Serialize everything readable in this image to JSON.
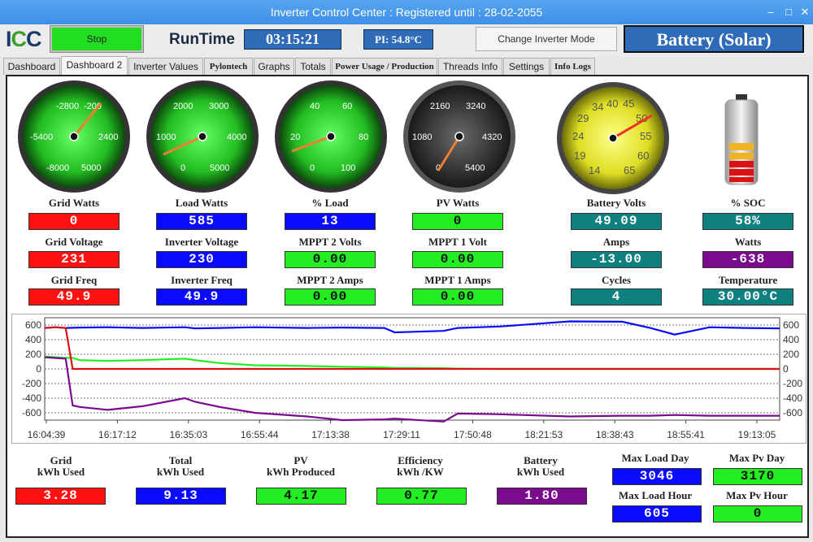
{
  "window": {
    "title": "Inverter Control Center : Registered until : 28-02-2055"
  },
  "header": {
    "logo": "ICC",
    "stop_label": "Stop",
    "runtime_label": "RunTime",
    "runtime": "03:15:21",
    "pi_temp": "PI: 54.8°C",
    "change_mode_label": "Change Inverter Mode",
    "mode": "Battery (Solar)"
  },
  "tabs": [
    "Dashboard",
    "Dashboard 2",
    "Inverter Values",
    "Pylontech",
    "Graphs",
    "Totals",
    "Power Usage / Production",
    "Threads Info",
    "Settings",
    "Info Logs"
  ],
  "active_tab": "Dashboard 2",
  "gauges": [
    {
      "name": "grid-watts-gauge",
      "ticks": [
        "-2800",
        "-200",
        "2400",
        "5000",
        "-8000",
        "-5400"
      ],
      "value": 0
    },
    {
      "name": "load-watts-gauge",
      "ticks": [
        "2000",
        "3000",
        "4000",
        "5000",
        "0",
        "1000"
      ],
      "value": 585
    },
    {
      "name": "load-percent-gauge",
      "ticks": [
        "40",
        "60",
        "80",
        "100",
        "0",
        "20"
      ],
      "value": 13
    },
    {
      "name": "pv-watts-gauge",
      "ticks": [
        "2160",
        "3240",
        "4320",
        "5400",
        "0",
        "1080"
      ],
      "value": 0
    },
    {
      "name": "battery-volts-gauge",
      "ticks": [
        "34",
        "40",
        "45",
        "50",
        "55",
        "60",
        "65",
        "14",
        "19",
        "24",
        "29"
      ],
      "value": 49.09
    }
  ],
  "metrics": {
    "grid_watts": {
      "label": "Grid Watts",
      "value": "0"
    },
    "load_watts": {
      "label": "Load Watts",
      "value": "585"
    },
    "load_pct": {
      "label": "% Load",
      "value": "13"
    },
    "pv_watts": {
      "label": "PV Watts",
      "value": "0"
    },
    "battery_volts": {
      "label": "Battery Volts",
      "value": "49.09"
    },
    "soc": {
      "label": "% SOC",
      "value": "58%"
    },
    "grid_voltage": {
      "label": "Grid Voltage",
      "value": "231"
    },
    "inverter_voltage": {
      "label": "Inverter Voltage",
      "value": "230"
    },
    "mppt2_volts": {
      "label": "MPPT 2 Volts",
      "value": "0.00"
    },
    "mppt1_volt": {
      "label": "MPPT 1 Volt",
      "value": "0.00"
    },
    "amps": {
      "label": "Amps",
      "value": "-13.00"
    },
    "watts": {
      "label": "Watts",
      "value": "-638"
    },
    "grid_freq": {
      "label": "Grid Freq",
      "value": "49.9"
    },
    "inverter_freq": {
      "label": "Inverter Freq",
      "value": "49.9"
    },
    "mppt2_amps": {
      "label": "MPPT 2 Amps",
      "value": "0.00"
    },
    "mppt1_amps": {
      "label": "MPPT 1 Amps",
      "value": "0.00"
    },
    "cycles": {
      "label": "Cycles",
      "value": "4"
    },
    "temperature": {
      "label": "Temperature",
      "value": "30.00°C"
    }
  },
  "totals": {
    "grid_kwh": {
      "label1": "Grid",
      "label2": "kWh Used",
      "value": "3.28"
    },
    "total_kwh": {
      "label1": "Total",
      "label2": "kWh Used",
      "value": "9.13"
    },
    "pv_kwh": {
      "label1": "PV",
      "label2": "kWh Produced",
      "value": "4.17"
    },
    "efficiency": {
      "label1": "Efficiency",
      "label2": "kWh /KW",
      "value": "0.77"
    },
    "battery_kwh": {
      "label1": "Battery",
      "label2": "kWh Used",
      "value": "1.80"
    },
    "max_load_day": {
      "label": "Max Load Day",
      "value": "3046"
    },
    "max_pv_day": {
      "label": "Max Pv Day",
      "value": "3170"
    },
    "max_load_hour": {
      "label": "Max Load Hour",
      "value": "605"
    },
    "max_pv_hour": {
      "label": "Max Pv Hour",
      "value": "0"
    }
  },
  "colors": {
    "red": "#ff1111",
    "blue": "#0a0aff",
    "green": "#22ee22",
    "teal": "#0f8080",
    "purple": "#7a0a8e"
  },
  "chart_data": {
    "type": "line",
    "ylim": [
      -700,
      700
    ],
    "yticks": [
      600,
      400,
      200,
      0,
      -200,
      -400,
      -600
    ],
    "xticks": [
      "16:04:39",
      "16:17:12",
      "16:35:03",
      "16:55:44",
      "17:13:38",
      "17:29:11",
      "17:50:48",
      "18:21:53",
      "18:38:43",
      "18:55:41",
      "19:13:05"
    ],
    "series": [
      {
        "color": "#0a0aff",
        "x": [
          0,
          3,
          6,
          10,
          18,
          28,
          40,
          43,
          50,
          60,
          75,
          85,
          97,
          100,
          114,
          118,
          130,
          150,
          165,
          173,
          180,
          190,
          200,
          210
        ],
        "values": [
          560,
          570,
          560,
          565,
          570,
          560,
          570,
          555,
          560,
          570,
          560,
          565,
          560,
          500,
          520,
          560,
          580,
          650,
          645,
          560,
          470,
          570,
          560,
          555
        ]
      },
      {
        "color": "#22ee22",
        "x": [
          0,
          3,
          6,
          8,
          10,
          18,
          28,
          40,
          43,
          50,
          60,
          75,
          85,
          97,
          100,
          114,
          118,
          130,
          150,
          165,
          173,
          180,
          190,
          210
        ],
        "values": [
          170,
          160,
          150,
          150,
          120,
          110,
          120,
          140,
          120,
          80,
          50,
          40,
          30,
          20,
          15,
          10,
          5,
          0,
          0,
          0,
          0,
          0,
          0,
          0
        ]
      },
      {
        "color": "#dd1111",
        "x": [
          0,
          3,
          6,
          8,
          210
        ],
        "values": [
          560,
          570,
          560,
          0,
          0
        ]
      },
      {
        "color": "#7a0a8e",
        "x": [
          0,
          3,
          6,
          8,
          10,
          18,
          28,
          40,
          43,
          50,
          60,
          75,
          85,
          97,
          100,
          114,
          118,
          130,
          150,
          165,
          173,
          180,
          190,
          210
        ],
        "values": [
          160,
          150,
          140,
          -500,
          -520,
          -560,
          -510,
          -400,
          -450,
          -520,
          -600,
          -650,
          -700,
          -690,
          -680,
          -720,
          -610,
          -620,
          -650,
          -640,
          -640,
          -630,
          -640,
          -640
        ]
      }
    ]
  }
}
